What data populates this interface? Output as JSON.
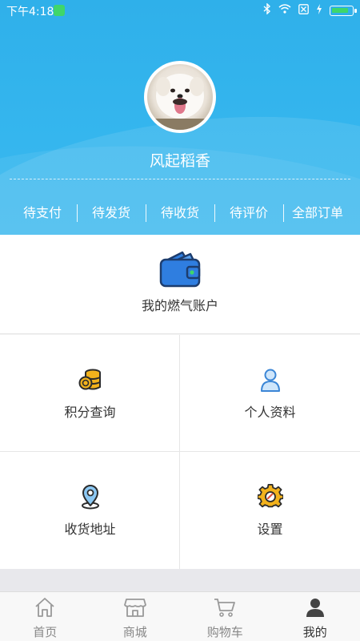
{
  "status_bar": {
    "time": "下午4:18"
  },
  "profile": {
    "username": "风起稻香"
  },
  "order_tabs": [
    {
      "label": "待支付"
    },
    {
      "label": "待发货"
    },
    {
      "label": "待收货"
    },
    {
      "label": "待评价"
    },
    {
      "label": "全部订单"
    }
  ],
  "account": {
    "label": "我的燃气账户"
  },
  "menu": [
    {
      "label": "积分查询",
      "icon": "coins-icon"
    },
    {
      "label": "个人资料",
      "icon": "person-icon"
    },
    {
      "label": "收货地址",
      "icon": "location-pin-icon"
    },
    {
      "label": "设置",
      "icon": "gear-icon"
    }
  ],
  "tabbar": [
    {
      "label": "首页",
      "icon": "home-icon"
    },
    {
      "label": "商城",
      "icon": "store-icon"
    },
    {
      "label": "购物车",
      "icon": "cart-icon"
    },
    {
      "label": "我的",
      "icon": "user-icon",
      "active": true
    }
  ],
  "colors": {
    "header_blue": "#35b6ee",
    "wallet_blue": "#2f7ee0",
    "accent_gold": "#f2b21c"
  }
}
